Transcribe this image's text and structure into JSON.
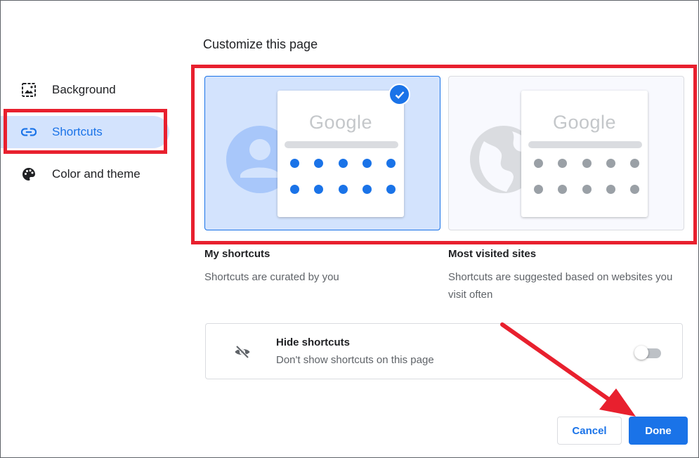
{
  "dialog": {
    "title": "Customize this page"
  },
  "sidebar": {
    "items": [
      {
        "label": "Background",
        "icon": "image-icon",
        "active": false
      },
      {
        "label": "Shortcuts",
        "icon": "link-icon",
        "active": true
      },
      {
        "label": "Color and theme",
        "icon": "palette-icon",
        "active": false
      }
    ]
  },
  "options": {
    "my_shortcuts": {
      "title": "My shortcuts",
      "description": "Shortcuts are curated by you",
      "selected": true,
      "logo_text": "Google"
    },
    "most_visited": {
      "title": "Most visited sites",
      "description": "Shortcuts are suggested based on websites you visit often",
      "selected": false,
      "logo_text": "Google"
    }
  },
  "hide_shortcuts": {
    "title": "Hide shortcuts",
    "description": "Don't show shortcuts on this page",
    "enabled": false
  },
  "buttons": {
    "cancel": "Cancel",
    "done": "Done"
  },
  "colors": {
    "accent": "#1a73e8",
    "selected_bg": "#d3e3fd",
    "annotation_red": "#e8202e"
  }
}
